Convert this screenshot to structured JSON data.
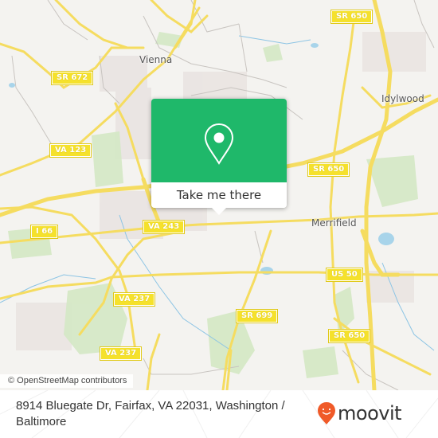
{
  "map": {
    "place_labels": [
      {
        "id": "vienna",
        "text": "Vienna"
      },
      {
        "id": "idylwood",
        "text": "Idylwood"
      },
      {
        "id": "merrifield",
        "text": "Merrifield"
      }
    ],
    "route_shields": [
      {
        "id": "sr672",
        "text": "SR 672"
      },
      {
        "id": "va123",
        "text": "VA 123"
      },
      {
        "id": "sr650-top",
        "text": "SR 650"
      },
      {
        "id": "sr650-mid",
        "text": "SR 650"
      },
      {
        "id": "i66",
        "text": "I 66"
      },
      {
        "id": "va243",
        "text": "VA 243"
      },
      {
        "id": "va237-a",
        "text": "VA 237"
      },
      {
        "id": "va237-b",
        "text": "VA 237"
      },
      {
        "id": "us50",
        "text": "US 50"
      },
      {
        "id": "sr699",
        "text": "SR 699"
      },
      {
        "id": "sr650-low",
        "text": "SR 650"
      }
    ],
    "attribution": "© OpenStreetMap contributors"
  },
  "popup": {
    "icon": "map-pin-icon",
    "button_label": "Take me there",
    "accent_color": "#1fb86a"
  },
  "footer": {
    "address": "8914 Bluegate Dr, Fairfax, VA 22031, Washington / Baltimore",
    "brand": "moovit",
    "brand_color": "#f05a28"
  }
}
